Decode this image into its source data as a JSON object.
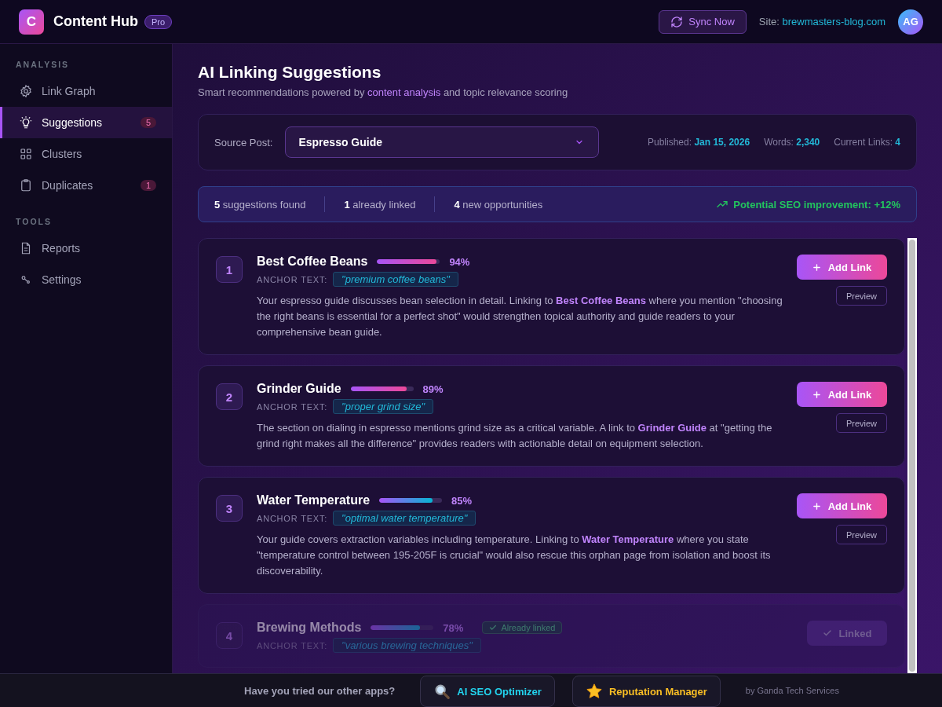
{
  "header": {
    "logo_letter": "C",
    "app_name": "Content Hub",
    "plan_badge": "Pro",
    "sync_button": "Sync Now",
    "site_label": "Site:",
    "site_url": "brewmasters-blog.com",
    "avatar_initials": "AG"
  },
  "sidebar": {
    "sections": [
      {
        "heading": "ANALYSIS",
        "items": [
          {
            "kind": "gear",
            "label": "Link Graph",
            "selected": false
          },
          {
            "kind": "bulb",
            "label": "Suggestions",
            "badge": "5",
            "selected": true
          },
          {
            "kind": "grid",
            "label": "Clusters",
            "selected": false
          },
          {
            "kind": "clipboard",
            "label": "Duplicates",
            "badge": "1",
            "selected": false
          }
        ]
      },
      {
        "heading": "TOOLS",
        "items": [
          {
            "kind": "file",
            "label": "Reports",
            "selected": false
          },
          {
            "kind": "nodes",
            "label": "Settings",
            "selected": false
          }
        ]
      }
    ]
  },
  "page": {
    "title": "AI Linking Suggestions",
    "subtitle": "Smart recommendations powered by **content analysis** and topic relevance scoring"
  },
  "source": {
    "label": "Source Post:",
    "selected_post": "Espresso Guide",
    "meta": [
      {
        "label": "Published:",
        "value": "Jan 15, 2026"
      },
      {
        "label": "Words:",
        "value": "2,340"
      },
      {
        "label": "Current Links:",
        "value": "4"
      }
    ]
  },
  "summary": {
    "stats": [
      {
        "count": "5",
        "text": "suggestions found"
      },
      {
        "count": "1",
        "text": "already linked"
      },
      {
        "count": "4",
        "text": "new opportunities"
      }
    ],
    "improvement": "Potential SEO improvement: +12%"
  },
  "suggestions": [
    {
      "number": "1",
      "title": "Best Coffee Beans",
      "level": 0.94,
      "score": "94%",
      "anchor_label": "ANCHOR TEXT:",
      "anchor": "\"premium coffee beans\"",
      "linked": false,
      "description": "Your espresso guide discusses bean selection in detail. Linking to **Best Coffee Beans** where you mention \"choosing the right beans is essential for a perfect shot\" would strengthen topical authority and guide readers to your comprehensive bean guide.",
      "action": "Add Link",
      "preview": "Preview"
    },
    {
      "number": "2",
      "title": "Grinder Guide",
      "level": 0.89,
      "score": "89%",
      "anchor_label": "ANCHOR TEXT:",
      "anchor": "\"proper grind size\"",
      "linked": false,
      "description": "The section on dialing in espresso mentions grind size as a critical variable. A link to **Grinder Guide** at \"getting the grind right makes all the difference\" provides readers with actionable detail on equipment selection.",
      "action": "Add Link",
      "preview": "Preview"
    },
    {
      "number": "3",
      "title": "Water Temperature",
      "level": 0.85,
      "score": "85%",
      "anchor_label": "ANCHOR TEXT:",
      "anchor": "\"optimal water temperature\"",
      "linked": false,
      "description": "Your guide covers extraction variables including temperature. Linking to **Water Temperature** where you state \"temperature control between 195-205F is crucial\" would also rescue this orphan page from isolation and boost its discoverability.",
      "action": "Add Link",
      "preview": "Preview"
    },
    {
      "number": "4",
      "title": "Brewing Methods",
      "level": 0.78,
      "score": "78%",
      "anchor_label": "ANCHOR TEXT:",
      "anchor": "\"various brewing techniques\"",
      "linked": true,
      "linked_badge": "Already linked",
      "action": "Linked"
    }
  ],
  "footer": {
    "prompt": "Have you tried our other apps?",
    "apps": [
      {
        "kind": "magnifier",
        "name": "AI SEO Optimizer",
        "color": "#22d3ee"
      },
      {
        "kind": "star",
        "name": "Reputation Manager",
        "color": "#fbbf24"
      }
    ],
    "credit": "by Ganda Tech Services"
  }
}
